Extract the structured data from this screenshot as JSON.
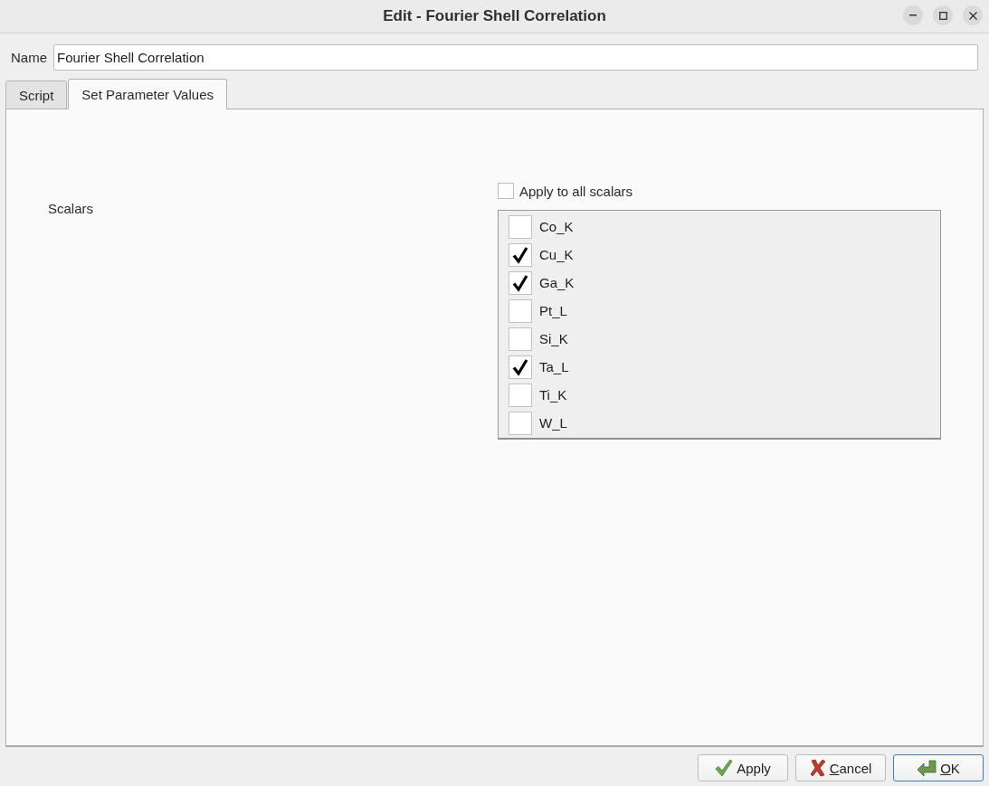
{
  "window": {
    "title": "Edit - Fourier Shell Correlation"
  },
  "name_field": {
    "label": "Name",
    "value": "Fourier Shell Correlation"
  },
  "tabs": [
    {
      "label": "Script",
      "selected": false
    },
    {
      "label": "Set Parameter Values",
      "selected": true
    }
  ],
  "parameters": {
    "label": "Scalars",
    "apply_all": {
      "label": "Apply to all scalars",
      "checked": false
    },
    "items": [
      {
        "label": "Co_K",
        "checked": false
      },
      {
        "label": "Cu_K",
        "checked": true
      },
      {
        "label": "Ga_K",
        "checked": true
      },
      {
        "label": "Pt_L",
        "checked": false
      },
      {
        "label": "Si_K",
        "checked": false
      },
      {
        "label": "Ta_L",
        "checked": true
      },
      {
        "label": "Ti_K",
        "checked": false
      },
      {
        "label": "W_L",
        "checked": false
      }
    ]
  },
  "buttons": [
    {
      "label": "Apply",
      "kind": "apply",
      "mnemonic": false,
      "default": false
    },
    {
      "label": "Cancel",
      "kind": "cancel",
      "mnemonic": true,
      "default": false
    },
    {
      "label": "OK",
      "kind": "ok",
      "mnemonic": true,
      "default": true
    }
  ]
}
